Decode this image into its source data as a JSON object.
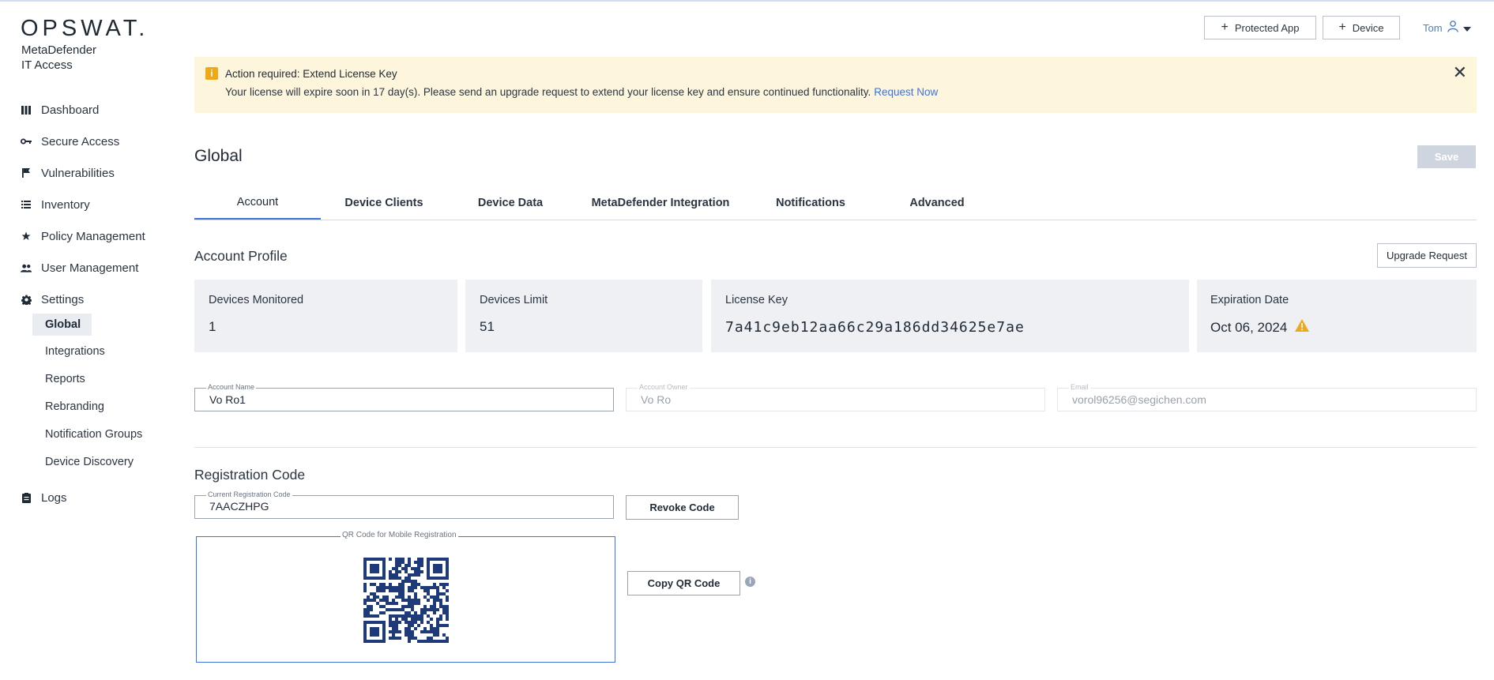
{
  "brand": {
    "logo": "OPSWAT.",
    "product_line1": "MetaDefender",
    "product_line2": "IT Access"
  },
  "sidebar": {
    "items": [
      {
        "label": "Dashboard",
        "icon": "dashboard-icon"
      },
      {
        "label": "Secure Access",
        "icon": "key-icon"
      },
      {
        "label": "Vulnerabilities",
        "icon": "flag-icon"
      },
      {
        "label": "Inventory",
        "icon": "list-icon"
      },
      {
        "label": "Policy Management",
        "icon": "star-icon"
      },
      {
        "label": "User Management",
        "icon": "users-icon"
      },
      {
        "label": "Settings",
        "icon": "gear-icon"
      },
      {
        "label": "Logs",
        "icon": "clipboard-icon"
      }
    ],
    "settings_sub": [
      "Global",
      "Integrations",
      "Reports",
      "Rebranding",
      "Notification Groups",
      "Device Discovery"
    ],
    "active_sub": "Global"
  },
  "topbar": {
    "protected_app_label": "Protected App",
    "device_label": "Device",
    "user_name": "Tom"
  },
  "banner": {
    "title": "Action required: Extend License Key",
    "message": "Your license will expire soon in 17 day(s). Please send an upgrade request to extend your license key and ensure continued functionality.",
    "link": "Request Now",
    "accent": "#f0a818"
  },
  "page": {
    "title": "Global",
    "save_label": "Save"
  },
  "tabs": [
    "Account",
    "Device Clients",
    "Device Data",
    "MetaDefender Integration",
    "Notifications",
    "Advanced"
  ],
  "active_tab": "Account",
  "account_profile": {
    "title": "Account Profile",
    "upgrade_label": "Upgrade Request",
    "cards": [
      {
        "label": "Devices Monitored",
        "value": "1"
      },
      {
        "label": "Devices Limit",
        "value": "51"
      },
      {
        "label": "License Key",
        "value": "7a41c9eb12aa66c29a186dd34625e7ae"
      },
      {
        "label": "Expiration Date",
        "value": "Oct 06, 2024"
      }
    ]
  },
  "fields": {
    "account_name": {
      "label": "Account Name",
      "value": "Vo Ro1"
    },
    "account_owner": {
      "label": "Account Owner",
      "value": "Vo Ro"
    },
    "email": {
      "label": "Email",
      "value": "vorol96256@segichen.com"
    }
  },
  "registration": {
    "title": "Registration Code",
    "code_label": "Current Registration Code",
    "code_value": "7AACZHPG",
    "revoke_label": "Revoke Code",
    "qr_label": "QR Code for Mobile Registration",
    "copy_qr_label": "Copy QR Code"
  },
  "colors": {
    "accent": "#3e73d8",
    "qr": "#1e3a78",
    "warning": "#f0a818"
  }
}
